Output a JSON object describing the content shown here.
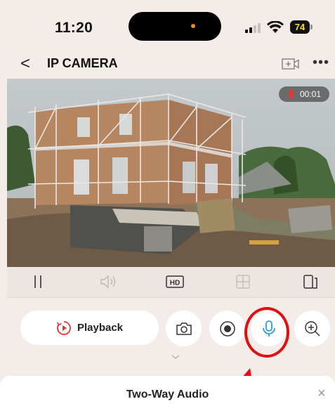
{
  "status_bar": {
    "time": "11:20",
    "battery": "74"
  },
  "nav": {
    "back_glyph": "<",
    "title": "IP CAMERA"
  },
  "video": {
    "recording_time": "00:01"
  },
  "controls": [
    "pause-icon",
    "speaker-icon",
    "hd-icon",
    "grid-icon",
    "rotate-icon"
  ],
  "actions": {
    "playback_label": "Playback",
    "icons": [
      "playback-icon",
      "snapshot-icon",
      "record-icon",
      "microphone-icon",
      "zoom-in-icon"
    ]
  },
  "sheet": {
    "title": "Two-Way Audio",
    "close_glyph": "×"
  },
  "colors": {
    "accent": "#2a9fd8",
    "annotation": "#e01010",
    "background": "#f4ece9"
  }
}
